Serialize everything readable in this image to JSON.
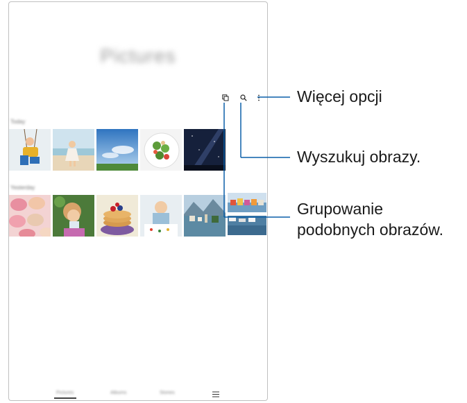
{
  "app": {
    "title": "Pictures"
  },
  "toolbar": {
    "group_icon": "group-similar-icon",
    "search_icon": "search-icon",
    "more_icon": "more-options-icon"
  },
  "sections": [
    {
      "label": "Today"
    },
    {
      "label": "Yesterday"
    }
  ],
  "thumbnails": {
    "today": [
      "boy-on-swing",
      "girl-on-beach",
      "sky-landscape",
      "salad-plate",
      "milky-way"
    ],
    "yesterday": [
      "macarons",
      "girl-drinking",
      "pancakes",
      "baby-drawing",
      "lake-village",
      "harbor-town"
    ]
  },
  "bottom_nav": {
    "tabs": [
      "Pictures",
      "Albums",
      "Stories"
    ],
    "menu_icon": "hamburger-icon"
  },
  "callouts": {
    "more_options": "Więcej opcji",
    "search": "Wyszukuj obrazy.",
    "group_line1": "Grupowanie",
    "group_line2": "podobnych obrazów."
  },
  "colors": {
    "line": "#0a5fa8",
    "icon": "#222222"
  }
}
